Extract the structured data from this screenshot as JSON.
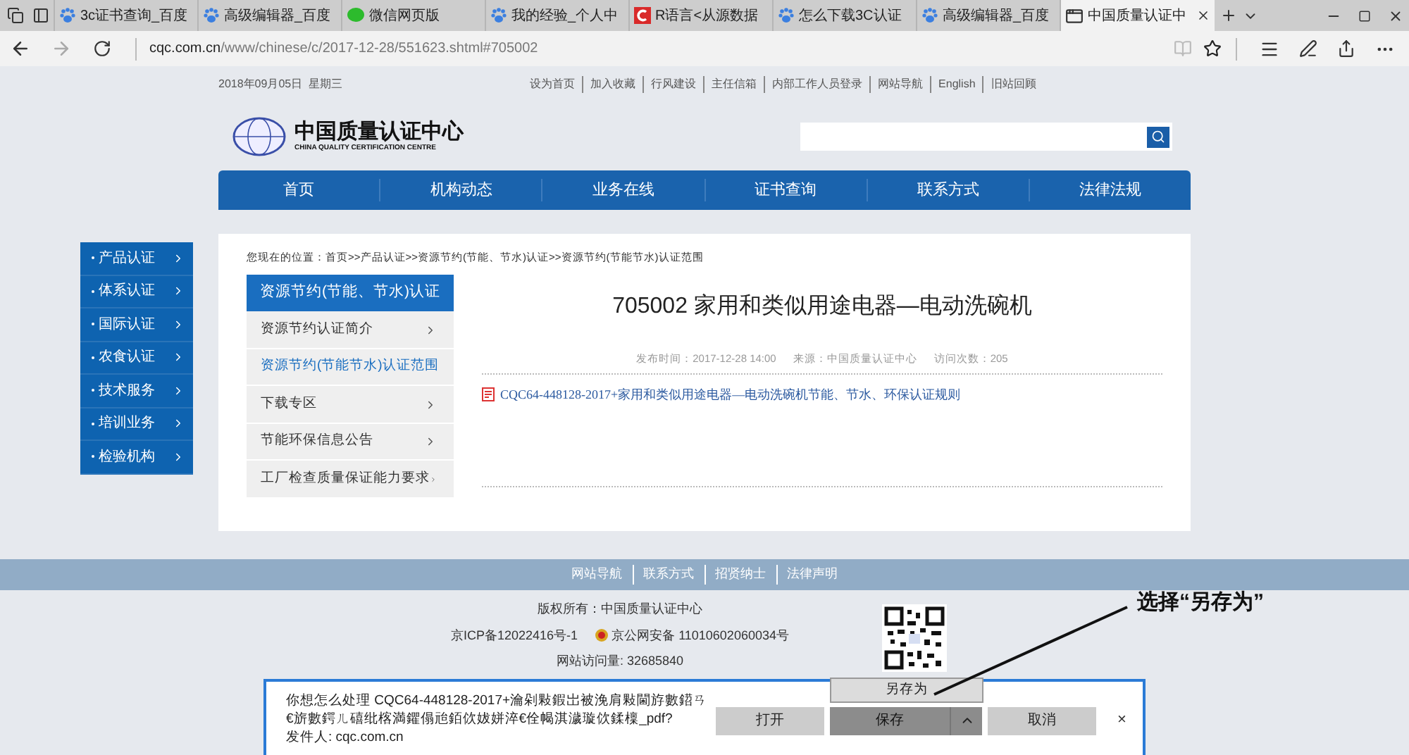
{
  "browser": {
    "tabs": [
      {
        "title": "3c证书查询_百度",
        "kind": "paw",
        "selected": false
      },
      {
        "title": "高级编辑器_百度",
        "kind": "paw",
        "selected": false
      },
      {
        "title": "微信网页版",
        "kind": "chat",
        "selected": false
      },
      {
        "title": "我的经验_个人中",
        "kind": "paw",
        "selected": false
      },
      {
        "title": "R语言<从源数据",
        "kind": "letter",
        "selected": false
      },
      {
        "title": "怎么下载3C认证",
        "kind": "paw",
        "selected": false
      },
      {
        "title": "高级编辑器_百度",
        "kind": "paw",
        "selected": false
      },
      {
        "title": "中国质量认证中",
        "kind": "page",
        "selected": true
      }
    ],
    "address": {
      "domain": "cqc.com.cn",
      "path": "/www/chinese/c/2017-12-28/551623.shtml#705002"
    }
  },
  "page": {
    "top_bar": {
      "date": "2018年09月05日  星期三",
      "links": [
        "设为首页",
        "加入收藏",
        "行风建设",
        "主任信箱",
        "内部工作人员登录",
        "网站导航",
        "English",
        "旧站回顾"
      ]
    },
    "logo": {
      "name": "中国质量认证中心",
      "subtitle": "CHINA QUALITY CERTIFICATION CENTRE"
    },
    "nav": [
      "首页",
      "机构动态",
      "业务在线",
      "证书查询",
      "联系方式",
      "法律法规"
    ],
    "sidebar": [
      "产品认证",
      "体系认证",
      "国际认证",
      "农食认证",
      "技术服务",
      "培训业务",
      "检验机构"
    ],
    "breadcrumb": "您现在的位置：首页>>产品认证>>资源节约(节能、节水)认证>>资源节约(节能节水)认证范围",
    "submenu": {
      "header": "资源节约(节能、节水)认证",
      "items": [
        {
          "label": "资源节约认证简介",
          "selected": false
        },
        {
          "label": "资源节约(节能节水)认证范围",
          "selected": true
        },
        {
          "label": "下载专区",
          "selected": false
        },
        {
          "label": "节能环保信息公告",
          "selected": false
        },
        {
          "label": "工厂检查质量保证能力要求",
          "selected": false
        }
      ]
    },
    "article": {
      "title": "705002 家用和类似用途电器—电动洗碗机",
      "meta": [
        "发布时间：2017-12-28 14:00",
        "来源：中国质量认证中心",
        "访问次数：205"
      ],
      "attachments": [
        "CQC64-448128-2017+家用和类似用途电器—电动洗碗机节能、节水、环保认证规则"
      ]
    },
    "footer": {
      "links": [
        "网站导航",
        "联系方式",
        "招贤纳士",
        "法律声明"
      ],
      "copyright": "版权所有：中国质量认证中心",
      "icp": "京ICP备12022416号-1",
      "police": "京公网安备 11010602060034号",
      "visits": "网站访问量: 32685840"
    }
  },
  "download_bar": {
    "message": "你想怎么处理 CQC64-448128-2017+瀹剁敤鍜岀被浼肩敤閫斿數鍣ㄢ€旂數鍔ㄦ礂纰楁満鑺傝兘銆佽妭姘淬€佺幆淇濊璇佽鍒檁_pdf?",
    "sender": "发件人: cqc.com.cn",
    "open": "打开",
    "save": "保存",
    "cancel": "取消",
    "close": "×",
    "menu_item": "另存为"
  },
  "annotation": "选择“另存为”"
}
